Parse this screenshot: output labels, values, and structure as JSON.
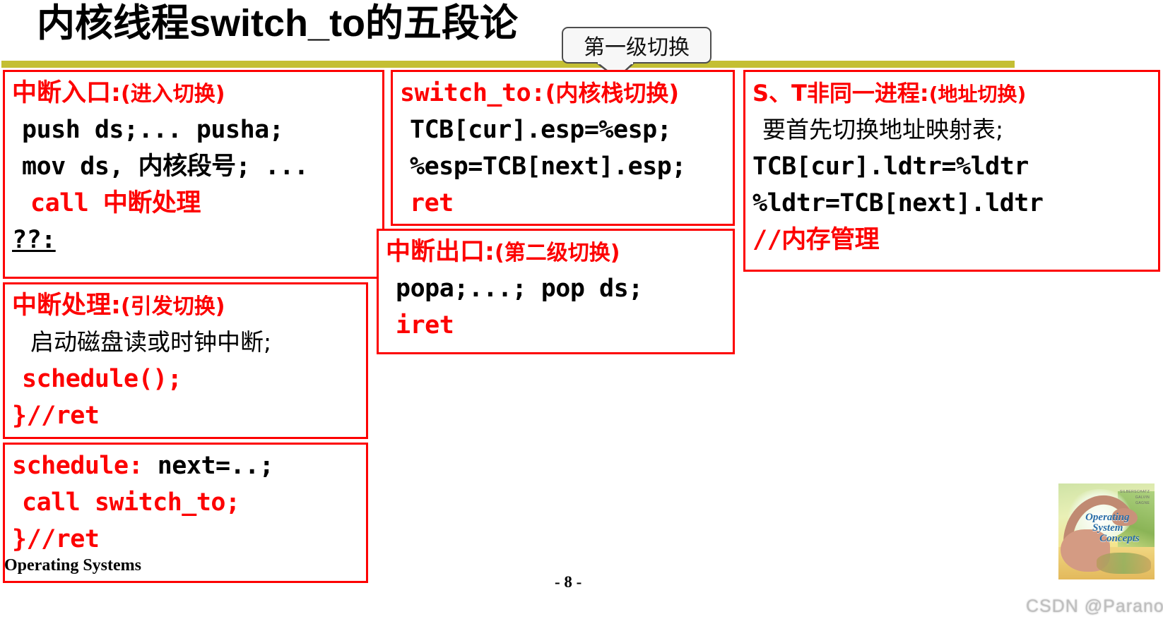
{
  "slide": {
    "title": "内核线程switch_to的五段论",
    "callout": "第一级切换",
    "footer_left": "Operating Systems",
    "page_number": "- 8 -",
    "watermark": "CSDN @Paranoid€",
    "accent_bar_color": "#c4bf33",
    "box_border_color": "#fd0000",
    "highlight_color": "#fd0000"
  },
  "boxes": {
    "interrupt_entry": {
      "heading_main": "中断入口:",
      "heading_paren": "(进入切换)",
      "lines": [
        "push ds;... pusha;",
        "mov ds, 内核段号; ...",
        "call 中断处理",
        "??:"
      ]
    },
    "interrupt_handler": {
      "heading_main": "中断处理:",
      "heading_paren": "(引发切换)",
      "lines": [
        "启动磁盘读或时钟中断;",
        "schedule();",
        "}//ret"
      ]
    },
    "schedule": {
      "label": "schedule:",
      "label_rest": " next=..;",
      "lines": [
        "call switch_to;",
        "}//ret"
      ]
    },
    "switch_to": {
      "heading_main": "switch_to:",
      "heading_paren": "(内核栈切换)",
      "lines": [
        "TCB[cur].esp=%esp;",
        "%esp=TCB[next].esp;",
        "ret"
      ]
    },
    "interrupt_exit": {
      "heading_main": "中断出口:",
      "heading_paren": "(第二级切换)",
      "lines": [
        "popa;...; pop ds;",
        "iret"
      ]
    },
    "address_switch": {
      "heading_main": "S、T非同一进程:",
      "heading_paren": "(地址切换)",
      "lines": [
        "要首先切换地址映射表;",
        "TCB[cur].ldtr=%ldtr",
        "%ldtr=TCB[next].ldtr",
        "//内存管理"
      ]
    }
  },
  "book_cover": {
    "authors": "SILBERSCHATZ\nGALVIN\nGAGNE",
    "title_line1": "Operating",
    "title_line2": "System",
    "title_line3": "Concepts"
  }
}
